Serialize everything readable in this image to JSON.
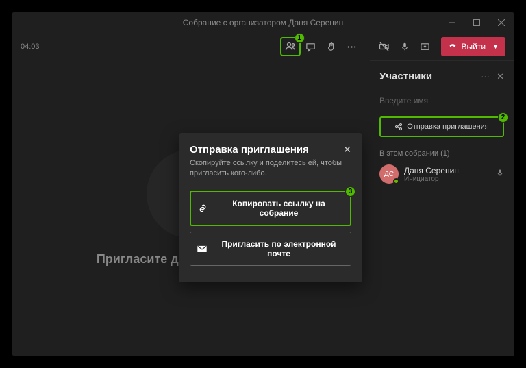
{
  "titlebar": {
    "title": "Собрание с организатором Даня Серенин"
  },
  "toolbar": {
    "timer": "04:03",
    "leave_label": "Выйти"
  },
  "main": {
    "invite_others": "Пригласите других участников"
  },
  "panel": {
    "title": "Участники",
    "name_placeholder": "Введите имя",
    "share_invite": "Отправка приглашения",
    "in_meeting_label": "В этом собрании (1)",
    "participant": {
      "initials": "ДС",
      "name": "Даня Серенин",
      "role": "Инициатор"
    }
  },
  "modal": {
    "title": "Отправка приглашения",
    "description": "Скопируйте ссылку и поделитесь ей, чтобы пригласить кого-либо.",
    "copy_link": "Копировать ссылку на собрание",
    "invite_email": "Пригласить по электронной почте"
  },
  "badges": {
    "b1": "1",
    "b2": "2",
    "b3": "3"
  }
}
